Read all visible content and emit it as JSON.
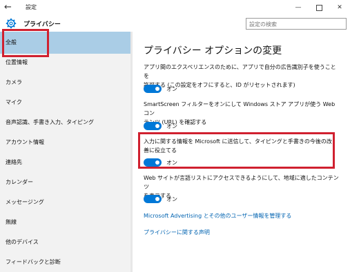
{
  "window": {
    "back_glyph": "←",
    "title": "設定",
    "minimize_glyph": "—",
    "close_glyph": "✕"
  },
  "header": {
    "title": "プライバシー",
    "icon": "gear-icon"
  },
  "search": {
    "placeholder": "設定の検索"
  },
  "sidebar": {
    "selected_index": 0,
    "items": [
      {
        "label": "全般"
      },
      {
        "label": "位置情報"
      },
      {
        "label": "カメラ"
      },
      {
        "label": "マイク"
      },
      {
        "label": "音声認識、手書き入力、タイピング"
      },
      {
        "label": "アカウント情報"
      },
      {
        "label": "連絡先"
      },
      {
        "label": "カレンダー"
      },
      {
        "label": "メッセージング"
      },
      {
        "label": "無線"
      },
      {
        "label": "他のデバイス"
      },
      {
        "label": "フィードバックと診断"
      }
    ]
  },
  "main": {
    "heading": "プライバシー オプションの変更",
    "settings": [
      {
        "line1": "アプリ間のエクスペリエンスのために、アプリで自分の広告識別子を使うことを",
        "line2": "許可する (この設定をオフにすると、ID がリセットされます)",
        "state": "オン",
        "on": true
      },
      {
        "line1": "SmartScreen フィルターをオンにして Windows ストア アプリが使う Web コン",
        "line2": "テンツ (URL) を確認する",
        "state": "オン",
        "on": true
      },
      {
        "line1": "入力に関する情報を Microsoft に送信して、タイピングと手書きの今後の改",
        "line2": "善に役立てる",
        "state": "オン",
        "on": true
      },
      {
        "line1": "Web サイトが言語リストにアクセスできるようにして、地域に適したコンテンツ",
        "line2": "を表示する",
        "state": "オン",
        "on": true
      }
    ],
    "links": [
      "Microsoft Advertising とその他のユーザー情報を管理する",
      "プライバシーに関する声明"
    ]
  },
  "colors": {
    "accent": "#0078d7",
    "selection": "#aacde6",
    "annotation_red": "#d0202f",
    "link": "#0063b1"
  }
}
